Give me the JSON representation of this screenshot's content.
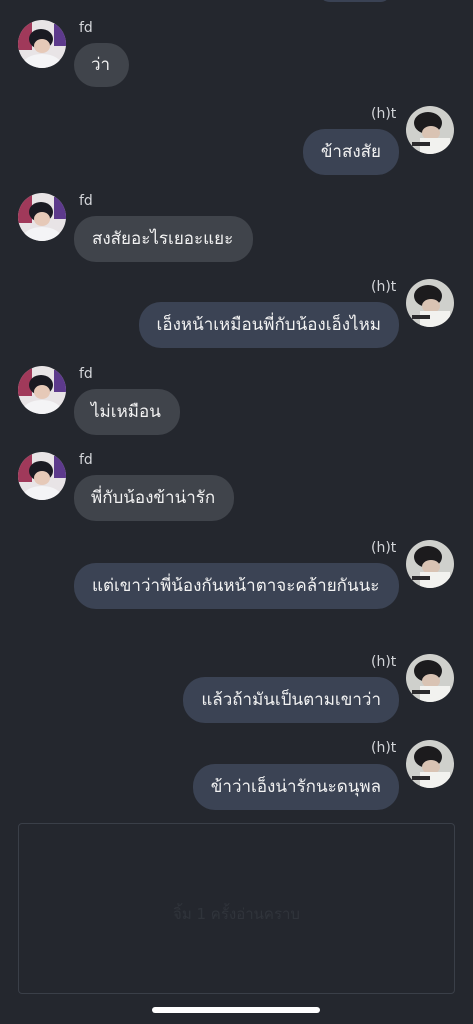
{
  "chat": {
    "placeholder": "จิ้ม 1 ครั้งอ่านคราบ",
    "messages": [
      {
        "sender": "fd",
        "side": "in",
        "text": "ว่า"
      },
      {
        "sender": "(h)t",
        "side": "out",
        "text": "ข้าสงสัย"
      },
      {
        "sender": "fd",
        "side": "in",
        "text": "สงสัยอะไรเยอะแยะ"
      },
      {
        "sender": "(h)t",
        "side": "out",
        "text": "เอ็งหน้าเหมือนพี่กับน้องเอ็งไหม"
      },
      {
        "sender": "fd",
        "side": "in",
        "text": "ไม่เหมือน"
      },
      {
        "sender": "fd",
        "side": "in",
        "text": "พี่กับน้องข้าน่ารัก"
      },
      {
        "sender": "(h)t",
        "side": "out",
        "text": "แต่เขาว่าพี่น้องกันหน้าตาจะคล้ายกันนะ"
      },
      {
        "sender": "(h)t",
        "side": "out",
        "text": "แล้วถ้ามันเป็นตามเขาว่า"
      },
      {
        "sender": "(h)t",
        "side": "out",
        "text": "ข้าว่าเอ็งน่ารักนะดนุพล"
      }
    ]
  },
  "colors": {
    "background": "#24272e",
    "incoming_bubble": "#40444b",
    "outgoing_bubble": "#3b4354",
    "text": "#f2f2f2"
  }
}
